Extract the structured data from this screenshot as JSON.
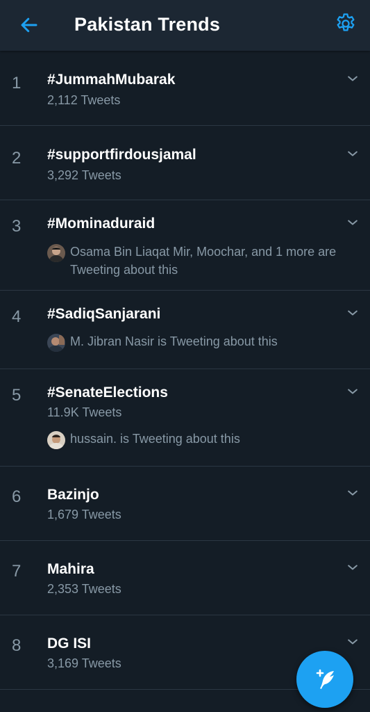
{
  "header": {
    "title": "Pakistan Trends",
    "back_icon": "arrow-left-icon",
    "settings_icon": "gear-icon",
    "accent_color": "#1da1f2"
  },
  "trends": [
    {
      "rank": "1",
      "name": "#JummahMubarak",
      "count": "2,112 Tweets"
    },
    {
      "rank": "2",
      "name": "#supportfirdousjamal",
      "count": "3,292 Tweets"
    },
    {
      "rank": "3",
      "name": "#Mominaduraid",
      "context": "Osama Bin Liaqat Mir, Moochar, and 1 more are Tweeting about this"
    },
    {
      "rank": "4",
      "name": "#SadiqSanjarani",
      "context": "M. Jibran Nasir is Tweeting about this"
    },
    {
      "rank": "5",
      "name": "#SenateElections",
      "count": "11.9K Tweets",
      "context": "hussain. is Tweeting about this"
    },
    {
      "rank": "6",
      "name": "Bazinjo",
      "count": "1,679 Tweets"
    },
    {
      "rank": "7",
      "name": "Mahira",
      "count": "2,353 Tweets"
    },
    {
      "rank": "8",
      "name": "DG ISI",
      "count": "3,169 Tweets"
    }
  ],
  "fab": {
    "icon": "compose-tweet-icon"
  },
  "colors": {
    "background": "#141d26",
    "header": "#1c2733",
    "secondary_text": "#8899a6",
    "divider": "#2b3743"
  }
}
